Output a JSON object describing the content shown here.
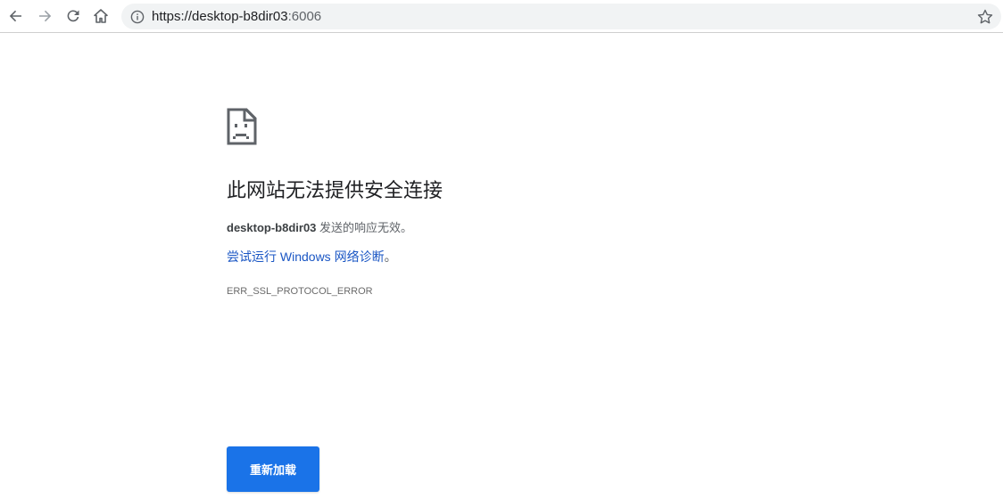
{
  "browser": {
    "url_main": "https://desktop-b8dir03",
    "url_port": ":6006",
    "icons": {
      "back": "back-arrow-icon",
      "forward": "forward-arrow-icon",
      "reload": "reload-icon",
      "home": "home-icon",
      "info": "info-icon",
      "bookmark": "star-icon"
    }
  },
  "error_page": {
    "icon": "sad-page-icon",
    "heading": "此网站无法提供安全连接",
    "host": "desktop-b8dir03",
    "description_suffix": " 发送的响应无效。",
    "suggestion_link": "尝试运行 Windows 网络诊断",
    "suggestion_tail": "。",
    "error_code": "ERR_SSL_PROTOCOL_ERROR",
    "reload_button": "重新加载"
  },
  "colors": {
    "accent": "#1a73e8",
    "link": "#1a56c4",
    "omnibox_bg": "#f1f3f4"
  }
}
